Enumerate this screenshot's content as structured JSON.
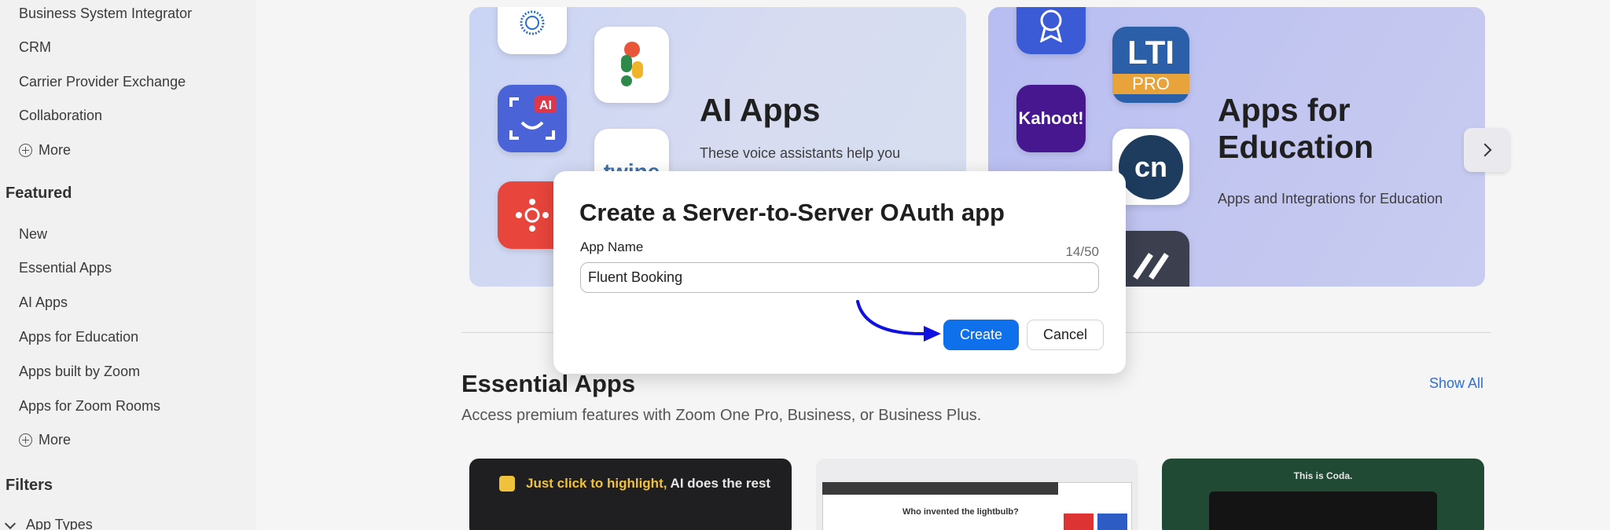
{
  "sidebar": {
    "top_items": [
      {
        "label": "Business System Integrator"
      },
      {
        "label": "CRM"
      },
      {
        "label": "Carrier Provider Exchange"
      },
      {
        "label": "Collaboration"
      }
    ],
    "more_label_1": "More",
    "featured_heading": "Featured",
    "featured_items": [
      {
        "label": "New"
      },
      {
        "label": "Essential Apps"
      },
      {
        "label": "AI Apps"
      },
      {
        "label": "Apps for Education"
      },
      {
        "label": "Apps built by Zoom"
      },
      {
        "label": "Apps for Zoom Rooms"
      }
    ],
    "more_label_2": "More",
    "filters_heading": "Filters",
    "app_types_label": "App Types"
  },
  "carousel": {
    "ai_card": {
      "title": "AI Apps",
      "description": "These voice assistants help you",
      "tile_ai_text": "AI",
      "tile_twine_text": "twine"
    },
    "edu_card": {
      "title_line1": "Apps for",
      "title_line2": "Education",
      "description": "Apps and Integrations for Education",
      "tile_lti_text": "LTI",
      "tile_pro_text": "PRO",
      "tile_kahoot_text": "Kahoot!",
      "tile_cn_text": "cn"
    }
  },
  "essential": {
    "title": "Essential Apps",
    "subtitle": "Access premium features with Zoom One Pro, Business, or Business Plus.",
    "show_all": "Show All",
    "thumb1_highlight": "Just click to highlight,",
    "thumb1_rest": " AI does the rest",
    "thumb2_text": "Who invented the lightbulb?",
    "thumb3_text": "This is Coda."
  },
  "dialog": {
    "title": "Create a Server-to-Server OAuth app",
    "field_label": "App Name",
    "counter": "14/50",
    "app_name_value": "Fluent Booking",
    "create_label": "Create",
    "cancel_label": "Cancel"
  },
  "colors": {
    "primary": "#0e71eb",
    "annotation_arrow": "#1010e0"
  }
}
